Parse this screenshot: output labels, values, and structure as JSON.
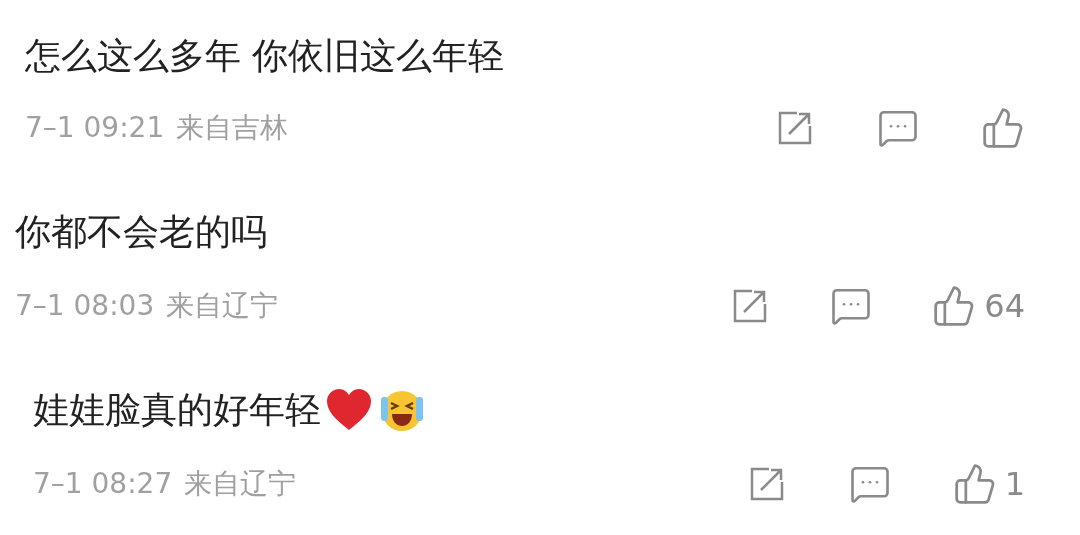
{
  "comments": [
    {
      "kind": "plain",
      "text": "怎么这么多年 你依旧这么年轻",
      "time": "7–1 09:21",
      "location": "来自吉林"
    },
    {
      "kind": "plain",
      "text": "你都不会老的吗",
      "time": "7–1 08:03",
      "location": "来自辽宁",
      "likes": "64"
    },
    {
      "kind": "emoji",
      "text": "娃娃脸真的好年轻",
      "time": "7–1 08:27",
      "location": "来自辽宁",
      "likes": "1"
    }
  ]
}
